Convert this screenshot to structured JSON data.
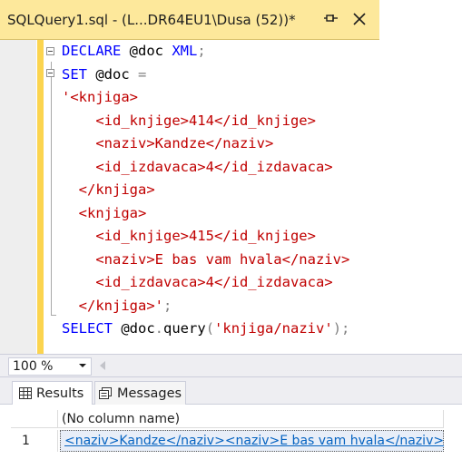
{
  "tab": {
    "title": "SQLQuery1.sql - (L...DR64EU1\\Dusa (52))*",
    "pin_icon": "pin-icon",
    "close_icon": "close-icon"
  },
  "editor": {
    "lines": [
      {
        "parts": [
          {
            "t": "DECLARE",
            "c": "kw"
          },
          {
            "t": " @doc ",
            "c": ""
          },
          {
            "t": "XML",
            "c": "kw"
          },
          {
            "t": ";",
            "c": "op"
          }
        ]
      },
      {
        "parts": [
          {
            "t": "SET",
            "c": "kw"
          },
          {
            "t": " @doc ",
            "c": ""
          },
          {
            "t": "=",
            "c": "op"
          }
        ]
      },
      {
        "parts": [
          {
            "t": "'<knjiga>",
            "c": "str"
          }
        ]
      },
      {
        "parts": [
          {
            "t": "    <id_knjige>414</id_knjige>",
            "c": "str"
          }
        ]
      },
      {
        "parts": [
          {
            "t": "    <naziv>Kandze</naziv>",
            "c": "str"
          }
        ]
      },
      {
        "parts": [
          {
            "t": "    <id_izdavaca>4</id_izdavaca>",
            "c": "str"
          }
        ]
      },
      {
        "parts": [
          {
            "t": "  </knjiga>",
            "c": "str"
          }
        ]
      },
      {
        "parts": [
          {
            "t": "  <knjiga>",
            "c": "str"
          }
        ]
      },
      {
        "parts": [
          {
            "t": "    <id_knjige>415</id_knjige>",
            "c": "str"
          }
        ]
      },
      {
        "parts": [
          {
            "t": "    <naziv>E bas vam hvala</naziv>",
            "c": "str"
          }
        ]
      },
      {
        "parts": [
          {
            "t": "    <id_izdavaca>4</id_izdavaca>",
            "c": "str"
          }
        ]
      },
      {
        "parts": [
          {
            "t": "  </knjiga>'",
            "c": "str"
          },
          {
            "t": ";",
            "c": "op"
          }
        ]
      },
      {
        "parts": [
          {
            "t": "SELECT",
            "c": "kw"
          },
          {
            "t": " @doc",
            "c": ""
          },
          {
            "t": ".",
            "c": "op"
          },
          {
            "t": "query",
            "c": ""
          },
          {
            "t": "(",
            "c": "op"
          },
          {
            "t": "'knjiga/naziv'",
            "c": "str"
          },
          {
            "t": ");",
            "c": "op"
          }
        ]
      }
    ]
  },
  "zoom": {
    "value": "100 %"
  },
  "results": {
    "tabs": [
      {
        "label": "Results",
        "icon": "grid-icon"
      },
      {
        "label": "Messages",
        "icon": "messages-icon"
      }
    ],
    "column_header": "(No column name)",
    "rows": [
      {
        "num": "1",
        "value": "<naziv>Kandze</naziv><naziv>E bas vam hvala</naziv>"
      }
    ]
  },
  "colors": {
    "tab_bg": "#fde89b",
    "keyword": "#0000ff",
    "string": "#c00000",
    "operator": "#808080",
    "link": "#0563c1"
  }
}
